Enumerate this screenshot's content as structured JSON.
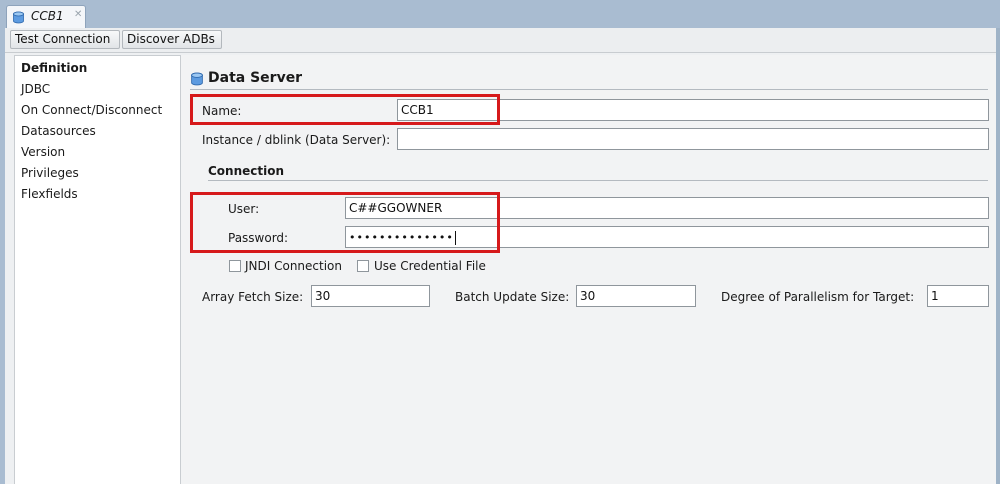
{
  "tab": {
    "title": "CCB1",
    "icon": "database-icon",
    "close_icon": "close-icon"
  },
  "toolbar": {
    "test_connection": "Test Connection",
    "discover_adbs": "Discover ADBs"
  },
  "sidebar": {
    "items": [
      {
        "label": "Definition",
        "selected": true
      },
      {
        "label": "JDBC"
      },
      {
        "label": "On Connect/Disconnect"
      },
      {
        "label": "Datasources"
      },
      {
        "label": "Version"
      },
      {
        "label": "Privileges"
      },
      {
        "label": "Flexfields"
      }
    ]
  },
  "data_server": {
    "title": "Data Server",
    "icon": "database-icon",
    "name_label": "Name:",
    "name_value": "CCB1",
    "instance_label": "Instance / dblink (Data Server):",
    "instance_value": ""
  },
  "connection": {
    "title": "Connection",
    "user_label": "User:",
    "user_value": "C##GGOWNER",
    "password_label": "Password:",
    "password_value": "••••••••••••••",
    "jndi_label": "JNDI Connection",
    "jndi_checked": false,
    "credential_label": "Use Credential File",
    "credential_checked": false
  },
  "fetch": {
    "array_label": "Array Fetch Size:",
    "array_value": "30",
    "batch_label": "Batch Update Size:",
    "batch_value": "30",
    "parallel_label": "Degree of Parallelism for Target:",
    "parallel_value": "1"
  },
  "colors": {
    "highlight": "#d6191b",
    "panel_bg": "#eef0f2",
    "window_bg": "#a9bcd1"
  }
}
